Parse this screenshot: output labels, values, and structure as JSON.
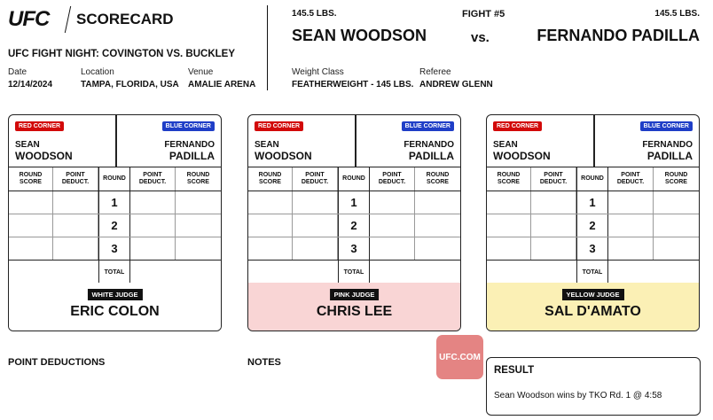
{
  "header": {
    "logo": "UFC",
    "title": "SCORECARD",
    "event": "UFC FIGHT NIGHT: COVINGTON VS. BUCKLEY",
    "date_label": "Date",
    "date": "12/14/2024",
    "location_label": "Location",
    "location": "TAMPA, FLORIDA, USA",
    "venue_label": "Venue",
    "venue": "AMALIE ARENA",
    "fight_number": "FIGHT #5",
    "red_weight": "145.5 LBS.",
    "blue_weight": "145.5 LBS.",
    "red_fighter": "SEAN WOODSON",
    "vs": "vs.",
    "blue_fighter": "FERNANDO PADILLA",
    "weight_class_label": "Weight Class",
    "weight_class": "FEATHERWEIGHT - 145 LBS.",
    "referee_label": "Referee",
    "referee": "ANDREW GLENN"
  },
  "labels": {
    "red_corner": "RED CORNER",
    "blue_corner": "BLUE CORNER",
    "round_score": "ROUND SCORE",
    "point_deduct": "POINT DEDUCT.",
    "round": "ROUND",
    "total": "TOTAL",
    "rounds": [
      "1",
      "2",
      "3"
    ]
  },
  "red_first": "SEAN",
  "red_last": "WOODSON",
  "blue_first": "FERNANDO",
  "blue_last": "PADILLA",
  "cards": [
    {
      "judge_tag": "WHITE JUDGE",
      "judge_name": "ERIC COLON",
      "bg": "#ffffff"
    },
    {
      "judge_tag": "PINK JUDGE",
      "judge_name": "CHRIS LEE",
      "bg": "#f9d5d5"
    },
    {
      "judge_tag": "YELLOW JUDGE",
      "judge_name": "SAL D'AMATO",
      "bg": "#fbf0b5"
    }
  ],
  "footer": {
    "point_deductions": "POINT DEDUCTIONS",
    "notes": "NOTES",
    "badge": "UFC.COM",
    "result_title": "RESULT",
    "result_text": "Sean Woodson wins by TKO Rd. 1 @ 4:58"
  }
}
